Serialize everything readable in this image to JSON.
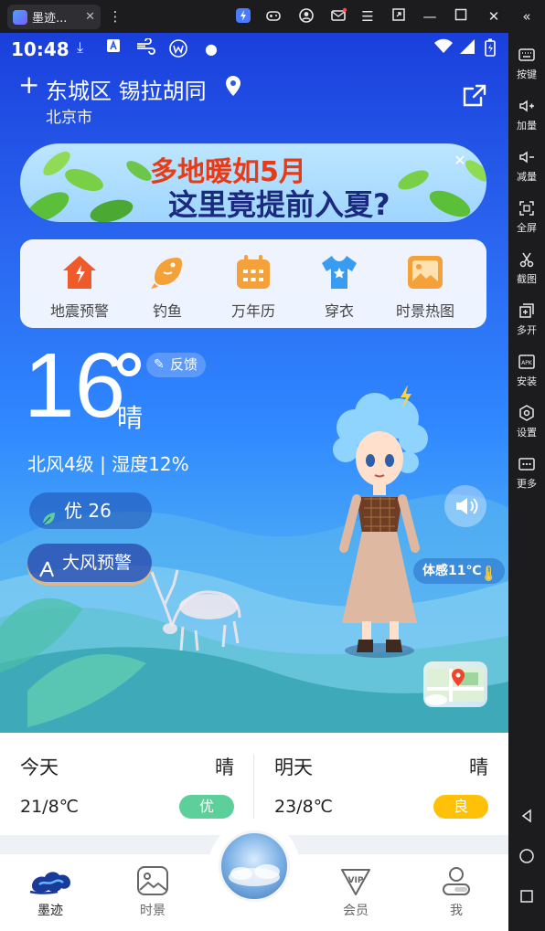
{
  "window": {
    "tab_title": "墨迹...",
    "tab_close": "✕"
  },
  "side_toolbar": [
    {
      "label": "按键",
      "icon": "keyboard-icon"
    },
    {
      "label": "加量",
      "icon": "volume-up-icon"
    },
    {
      "label": "减量",
      "icon": "volume-down-icon"
    },
    {
      "label": "全屏",
      "icon": "fullscreen-icon"
    },
    {
      "label": "截图",
      "icon": "scissors-icon"
    },
    {
      "label": "多开",
      "icon": "multi-instance-icon"
    },
    {
      "label": "安装",
      "icon": "apk-install-icon"
    },
    {
      "label": "设置",
      "icon": "settings-icon"
    },
    {
      "label": "更多",
      "icon": "more-icon"
    }
  ],
  "status_bar": {
    "time": "10:48"
  },
  "location": {
    "district": "东城区 锡拉胡同",
    "city": "北京市",
    "add_symbol": "+"
  },
  "banner": {
    "line1": "多地暖如5月",
    "line2": "这里竟提前入夏?"
  },
  "quick_menu": [
    {
      "label": "地震预警",
      "icon": "earthquake-house-icon",
      "color": "#f0592a"
    },
    {
      "label": "钓鱼",
      "icon": "fish-icon",
      "color": "#f5a13a"
    },
    {
      "label": "万年历",
      "icon": "calendar-icon",
      "color": "#f5a13a"
    },
    {
      "label": "穿衣",
      "icon": "tshirt-icon",
      "color": "#3a9cf0"
    },
    {
      "label": "时景热图",
      "icon": "image-icon",
      "color": "#f5a13a"
    }
  ],
  "current": {
    "temperature": "16",
    "condition": "晴",
    "feedback_label": "反馈",
    "wind_humidity": "北风4级 | 湿度12%",
    "aqi_label": "优 26",
    "alert_label": "大风预警",
    "feels_like": "体感11℃"
  },
  "forecast": [
    {
      "day": "今天",
      "condition": "晴",
      "temp": "21/8℃",
      "aqi": "优",
      "aqi_color": "#5ccf9a"
    },
    {
      "day": "明天",
      "condition": "晴",
      "temp": "23/8℃",
      "aqi": "良",
      "aqi_color": "#ffc107"
    }
  ],
  "bottom_nav": [
    {
      "label": "墨迹",
      "icon": "moji-cloud-icon",
      "active": true
    },
    {
      "label": "时景",
      "icon": "photo-icon",
      "active": false
    },
    {
      "label": "会员",
      "icon": "vip-icon",
      "active": false
    },
    {
      "label": "我",
      "icon": "profile-icon",
      "active": false
    }
  ]
}
